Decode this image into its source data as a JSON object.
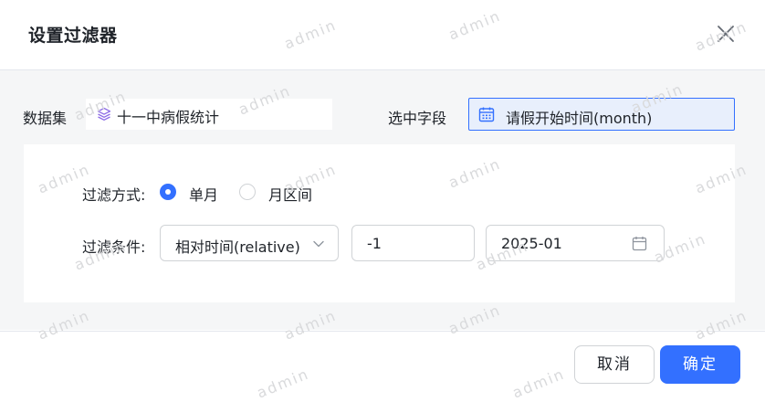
{
  "dialog": {
    "title": "设置过滤器"
  },
  "dataset": {
    "label": "数据集",
    "value": "十一中病假统计"
  },
  "field": {
    "label": "选中字段",
    "value": "请假开始时间(month)"
  },
  "filter_mode": {
    "label": "过滤方式:",
    "options": [
      {
        "label": "单月",
        "checked": true
      },
      {
        "label": "月区间",
        "checked": false
      }
    ]
  },
  "filter_condition": {
    "label": "过滤条件:",
    "type_value": "相对时间(relative)",
    "offset_value": "-1",
    "date_value": "2025-01"
  },
  "footer": {
    "cancel_label": "取消",
    "ok_label": "确定"
  },
  "watermark": {
    "text": "admin"
  },
  "colors": {
    "accent": "#3370ff",
    "dataset_icon": "#8c6ae6",
    "field_bg": "#e8effc"
  }
}
